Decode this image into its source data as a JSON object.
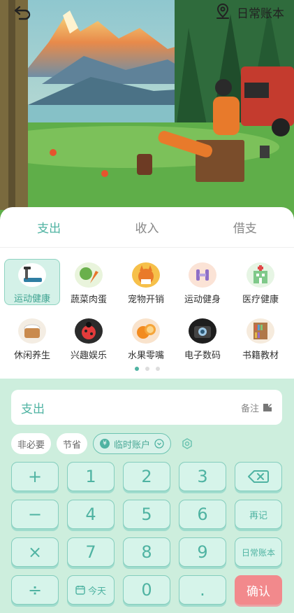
{
  "header": {
    "back_icon": "back-arrow-icon",
    "book_icon": "location-pin-icon",
    "book_label": "日常账本"
  },
  "tabs": [
    {
      "label": "支出",
      "active": true
    },
    {
      "label": "收入",
      "active": false
    },
    {
      "label": "借支",
      "active": false
    }
  ],
  "categories": [
    {
      "label": "运动健康",
      "icon": "treadmill-icon",
      "selected": true
    },
    {
      "label": "蔬菜肉蛋",
      "icon": "vegetable-icon",
      "selected": false
    },
    {
      "label": "宠物开销",
      "icon": "cat-icon",
      "selected": false
    },
    {
      "label": "运动健身",
      "icon": "dumbbell-icon",
      "selected": false
    },
    {
      "label": "医疗健康",
      "icon": "hospital-icon",
      "selected": false
    },
    {
      "label": "休闲养生",
      "icon": "bath-tub-icon",
      "selected": false
    },
    {
      "label": "兴趣娱乐",
      "icon": "ladybug-icon",
      "selected": false
    },
    {
      "label": "水果零嘴",
      "icon": "orange-icon",
      "selected": false
    },
    {
      "label": "电子数码",
      "icon": "camera-icon",
      "selected": false
    },
    {
      "label": "书籍教材",
      "icon": "bookshelf-icon",
      "selected": false
    }
  ],
  "pager": {
    "pages": 3,
    "current": 1
  },
  "amount": {
    "type_label": "支出",
    "note_label": "备注"
  },
  "tags": {
    "tag1": "非必要",
    "tag2": "节省",
    "account": "临时账户"
  },
  "keypad": {
    "plus": "+",
    "minus": "−",
    "times": "×",
    "divide": "÷",
    "k1": "1",
    "k2": "2",
    "k3": "3",
    "k4": "4",
    "k5": "5",
    "k6": "6",
    "k7": "7",
    "k8": "8",
    "k9": "9",
    "k0": "0",
    "dot": ".",
    "today": "今天",
    "again": "再记",
    "book": "日常账本",
    "confirm": "确认"
  },
  "colors": {
    "accent": "#4fb3a2",
    "confirm": "#f2898c",
    "keypad_bg": "#cdeedd"
  }
}
